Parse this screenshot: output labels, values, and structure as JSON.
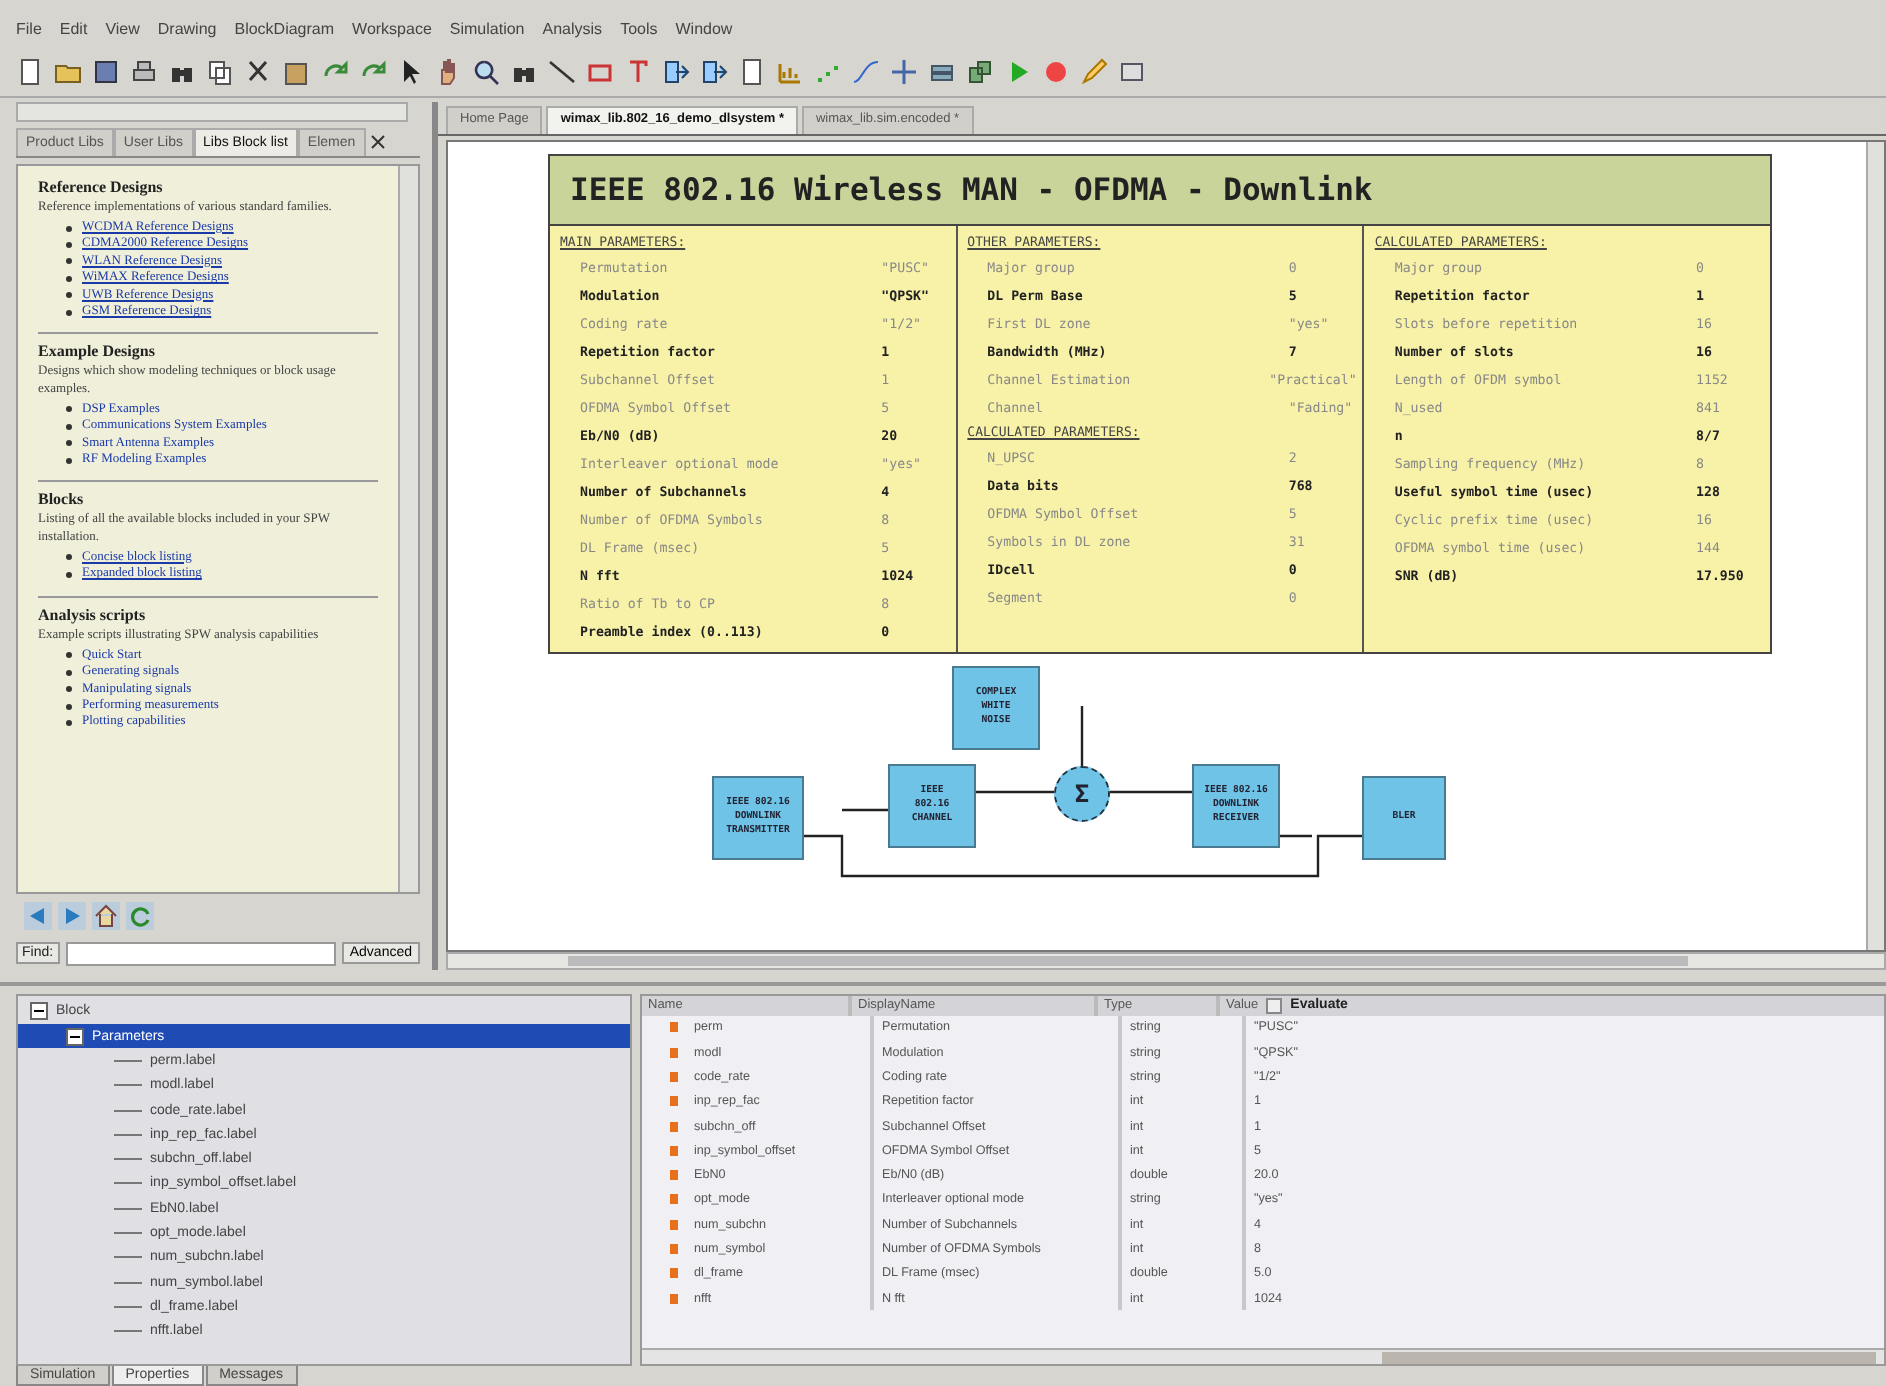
{
  "menu": [
    "File",
    "Edit",
    "View",
    "Drawing",
    "BlockDiagram",
    "Workspace",
    "Simulation",
    "Analysis",
    "Tools",
    "Window"
  ],
  "library_panel": {
    "tabs": [
      {
        "label": "Product Libs",
        "selected": false
      },
      {
        "label": "User Libs",
        "selected": false
      },
      {
        "label": "Libs Block list",
        "selected": true
      },
      {
        "label": "Elemen",
        "selected": false
      }
    ],
    "sections": [
      {
        "heading": "Reference Designs",
        "text": "Reference implementations of various standard families.",
        "links": [
          "WCDMA Reference Designs",
          "CDMA2000 Reference Designs",
          "WLAN Reference Designs",
          "WiMAX Reference Designs",
          "UWB Reference Designs",
          "GSM Reference Designs"
        ],
        "underlined": true
      },
      {
        "heading": "Example Designs",
        "text": "Designs which show modeling techniques or block usage examples.",
        "links": [
          "DSP Examples",
          "Communications System Examples",
          "Smart Antenna Examples",
          "RF Modeling Examples"
        ],
        "underlined": false
      },
      {
        "heading": "Blocks",
        "text": "Listing of all the available blocks included in your SPW installation.",
        "links": [
          "Concise block listing",
          "Expanded block listing"
        ],
        "underlined": true
      },
      {
        "heading": "Analysis scripts",
        "text": "Example scripts illustrating SPW analysis capabilities",
        "links": [
          "Quick Start",
          "Generating signals",
          "Manipulating signals",
          "Performing measurements",
          "Plotting capabilities"
        ],
        "underlined": false
      }
    ],
    "find_label": "Find:",
    "advanced_button": "Advanced"
  },
  "editor_tabs": [
    {
      "label": "Home Page",
      "selected": false
    },
    {
      "label": "wimax_lib.802_16_demo_dlsystem *",
      "selected": true
    },
    {
      "label": "wimax_lib.sim.encoded *",
      "selected": false
    }
  ],
  "poster": {
    "title": "IEEE 802.16 Wireless MAN - OFDMA - Downlink",
    "columns": [
      {
        "sections": [
          {
            "heading": "MAIN PARAMETERS:",
            "rows": [
              {
                "label": "Permutation",
                "value": "\"PUSC\"",
                "bold": false
              },
              {
                "label": "Modulation",
                "value": "\"QPSK\"",
                "bold": true
              },
              {
                "label": "Coding rate",
                "value": "\"1/2\"",
                "bold": false
              },
              {
                "label": "Repetition factor",
                "value": "1",
                "bold": true
              },
              {
                "label": "Subchannel Offset",
                "value": "1",
                "bold": false
              },
              {
                "label": "OFDMA Symbol Offset",
                "value": "5",
                "bold": false
              },
              {
                "label": "Eb/N0 (dB)",
                "value": "20",
                "bold": true
              },
              {
                "label": "Interleaver optional mode",
                "value": "\"yes\"",
                "bold": false
              },
              {
                "label": "Number of Subchannels",
                "value": "4",
                "bold": true
              },
              {
                "label": "Number of OFDMA Symbols",
                "value": "8",
                "bold": false
              },
              {
                "label": "DL Frame (msec)",
                "value": "5",
                "bold": false
              },
              {
                "label": "N fft",
                "value": "1024",
                "bold": true
              },
              {
                "label": "Ratio of Tb to CP",
                "value": "8",
                "bold": false
              },
              {
                "label": "Preamble index (0..113)",
                "value": "0",
                "bold": true
              }
            ]
          }
        ]
      },
      {
        "sections": [
          {
            "heading": "OTHER PARAMETERS:",
            "rows": [
              {
                "label": "Major group",
                "value": "0",
                "bold": false
              },
              {
                "label": "DL Perm Base",
                "value": "5",
                "bold": true
              },
              {
                "label": "First DL zone",
                "value": "\"yes\"",
                "bold": false
              },
              {
                "label": "Bandwidth (MHz)",
                "value": "7",
                "bold": true
              },
              {
                "label": "Channel Estimation",
                "value": "\"Practical\"",
                "bold": false
              },
              {
                "label": "Channel",
                "value": "\"Fading\"",
                "bold": false
              }
            ]
          },
          {
            "heading": "CALCULATED PARAMETERS:",
            "rows": [
              {
                "label": "N_UPSC",
                "value": "2",
                "bold": false
              },
              {
                "label": "Data bits",
                "value": "768",
                "bold": true
              },
              {
                "label": "OFDMA Symbol Offset",
                "value": "5",
                "bold": false
              },
              {
                "label": "Symbols in DL zone",
                "value": "31",
                "bold": false
              },
              {
                "label": "IDcell",
                "value": "0",
                "bold": true
              },
              {
                "label": "Segment",
                "value": "0",
                "bold": false
              }
            ]
          }
        ]
      },
      {
        "sections": [
          {
            "heading": "CALCULATED PARAMETERS:",
            "rows": [
              {
                "label": "Major group",
                "value": "0",
                "bold": false
              },
              {
                "label": "Repetition factor",
                "value": "1",
                "bold": true
              },
              {
                "label": "Slots before repetition",
                "value": "16",
                "bold": false
              },
              {
                "label": "Number of slots",
                "value": "16",
                "bold": true
              },
              {
                "label": "Length of OFDM symbol",
                "value": "1152",
                "bold": false
              },
              {
                "label": "N_used",
                "value": "841",
                "bold": false
              },
              {
                "label": "n",
                "value": "8/7",
                "bold": true
              },
              {
                "label": "Sampling frequency (MHz)",
                "value": "8",
                "bold": false
              },
              {
                "label": "Useful symbol time (usec)",
                "value": "128",
                "bold": true
              },
              {
                "label": "Cyclic prefix time (usec)",
                "value": "16",
                "bold": false
              },
              {
                "label": "OFDMA symbol time (usec)",
                "value": "144",
                "bold": false
              },
              {
                "label": "SNR (dB)",
                "value": "17.950",
                "bold": true
              }
            ]
          }
        ]
      }
    ]
  },
  "diagram": {
    "blocks": [
      {
        "kind": "block",
        "lines": [
          "IEEE 802.16",
          "DOWNLINK",
          "TRANSMITTER"
        ]
      },
      {
        "kind": "block",
        "lines": [
          "IEEE",
          "802.16",
          "CHANNEL"
        ]
      },
      {
        "kind": "block",
        "lines": [
          "COMPLEX",
          "WHITE",
          "NOISE"
        ]
      },
      {
        "kind": "sum",
        "lines": [
          "Σ"
        ]
      },
      {
        "kind": "block",
        "lines": [
          "IEEE 802.16",
          "DOWNLINK",
          "RECEIVER"
        ]
      },
      {
        "kind": "block",
        "lines": [
          "BLER"
        ]
      }
    ]
  },
  "tree": [
    {
      "label": "Block",
      "expanded": true,
      "selected": false,
      "children": [
        {
          "label": "Parameters",
          "expanded": true,
          "selected": true,
          "children": [
            {
              "label": "perm.label",
              "selected": false
            },
            {
              "label": "modl.label",
              "selected": false
            },
            {
              "label": "code_rate.label",
              "selected": false
            },
            {
              "label": "inp_rep_fac.label",
              "selected": false
            },
            {
              "label": "subchn_off.label",
              "selected": false
            },
            {
              "label": "inp_symbol_offset.label",
              "selected": false
            },
            {
              "label": "EbN0.label",
              "selected": false
            },
            {
              "label": "opt_mode.label",
              "selected": false
            },
            {
              "label": "num_subchn.label",
              "selected": false
            },
            {
              "label": "num_symbol.label",
              "selected": false
            },
            {
              "label": "dl_frame.label",
              "selected": false
            },
            {
              "label": "nfft.label",
              "selected": false
            }
          ]
        }
      ]
    }
  ],
  "properties": {
    "columns": [
      "Name",
      "DisplayName",
      "Type",
      "Value"
    ],
    "evaluate_label": "Evaluate",
    "evaluate_checked": false,
    "rows": [
      [
        "perm",
        "Permutation",
        "string",
        "\"PUSC\""
      ],
      [
        "modl",
        "Modulation",
        "string",
        "\"QPSK\""
      ],
      [
        "code_rate",
        "Coding rate",
        "string",
        "\"1/2\""
      ],
      [
        "inp_rep_fac",
        "Repetition factor",
        "int",
        "1"
      ],
      [
        "subchn_off",
        "Subchannel Offset",
        "int",
        "1"
      ],
      [
        "inp_symbol_offset",
        "OFDMA Symbol Offset",
        "int",
        "5"
      ],
      [
        "EbN0",
        "Eb/N0 (dB)",
        "double",
        "20.0"
      ],
      [
        "opt_mode",
        "Interleaver optional mode",
        "string",
        "\"yes\""
      ],
      [
        "num_subchn",
        "Number of Subchannels",
        "int",
        "4"
      ],
      [
        "num_symbol",
        "Number of OFDMA Symbols",
        "int",
        "8"
      ],
      [
        "dl_frame",
        "DL Frame (msec)",
        "double",
        "5.0"
      ],
      [
        "nfft",
        "N fft",
        "int",
        "1024"
      ]
    ]
  },
  "bottom_tabs": [
    {
      "label": "Simulation",
      "selected": false
    },
    {
      "label": "Properties",
      "selected": true
    },
    {
      "label": "Messages",
      "selected": false
    }
  ]
}
